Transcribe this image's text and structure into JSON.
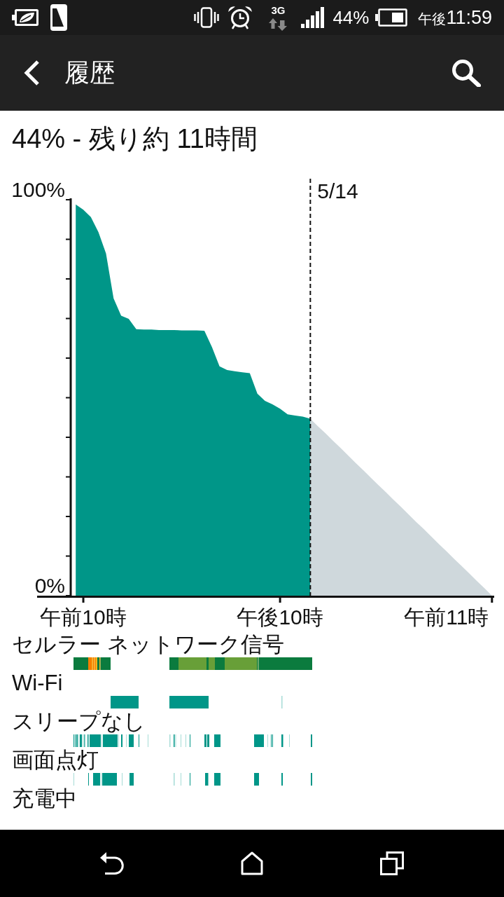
{
  "status_bar": {
    "network_type": "3G",
    "battery_text": "44%",
    "time_period": "午後",
    "time": "11:59"
  },
  "app_bar": {
    "title": "履歴"
  },
  "battery_summary": "44% - 残り約 11時間",
  "battery_chart": {
    "chart_data": {
      "type": "area",
      "categories": [
        null,
        "午前10時",
        null,
        null,
        null,
        null,
        null,
        null,
        null,
        null,
        null,
        null,
        null,
        null,
        null,
        null,
        null,
        null,
        null,
        null,
        null,
        null,
        null,
        null,
        null,
        null,
        null,
        "午後10時",
        null,
        null,
        null,
        null,
        null,
        null,
        null,
        null,
        null,
        null,
        null,
        null,
        null,
        null,
        null,
        null,
        null,
        null,
        null,
        null,
        null,
        "午前11時",
        null,
        null,
        null,
        null,
        null,
        null
      ],
      "series": [
        {
          "color": "#009688",
          "values": [
            98.8,
            97.5,
            95.6,
            91.8,
            86.4,
            75.1,
            70.7,
            69.9,
            67.3,
            67.2,
            67.2,
            67.1,
            67.1,
            67.1,
            67.0,
            67.0,
            67.0,
            66.9,
            62.8,
            57.9,
            57.0,
            56.7,
            56.4,
            56.2,
            51.0,
            49.2,
            48.3,
            47.2,
            45.8,
            45.5,
            45.2,
            44.7,
            null,
            null,
            null,
            null,
            null,
            null,
            null,
            null,
            null,
            null,
            null,
            null,
            null,
            null,
            null,
            null,
            null,
            null,
            null,
            null,
            null,
            null,
            null,
            null
          ]
        },
        {
          "color": "#cfd8dc",
          "values": [
            null,
            null,
            null,
            null,
            null,
            null,
            null,
            null,
            null,
            null,
            null,
            null,
            null,
            null,
            null,
            null,
            null,
            null,
            null,
            null,
            null,
            null,
            null,
            null,
            null,
            null,
            null,
            null,
            null,
            null,
            null,
            44.7,
            42.8,
            41.0,
            39.1,
            37.3,
            35.4,
            33.5,
            31.7,
            29.8,
            27.9,
            26.1,
            24.2,
            22.4,
            20.5,
            18.6,
            16.8,
            14.9,
            13.0,
            11.2,
            9.3,
            7.5,
            5.6,
            3.7,
            1.9,
            0
          ]
        }
      ],
      "ylim": [
        0,
        100
      ],
      "yticks": [
        {
          "value": 0,
          "label": "0%"
        },
        {
          "value": 100,
          "label": "100%"
        }
      ],
      "annotations": [
        "5/14"
      ]
    }
  },
  "activity_rows": [
    {
      "label": "セルラー ネットワーク信号",
      "kind": "signal"
    },
    {
      "label": "Wi-Fi",
      "kind": "wifi"
    },
    {
      "label": "スリープなし",
      "kind": "awake"
    },
    {
      "label": "画面点灯",
      "kind": "screen"
    },
    {
      "label": "充電中",
      "kind": "charging"
    }
  ]
}
